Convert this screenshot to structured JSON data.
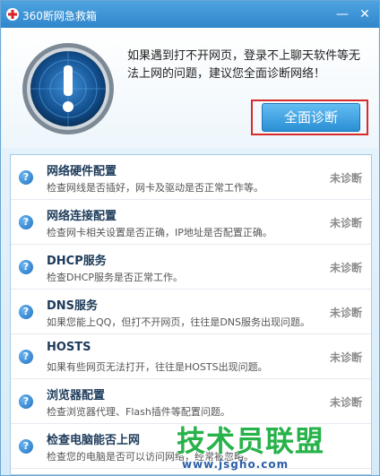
{
  "window": {
    "title": "360断网急救箱",
    "minimize": "—",
    "close": "✕"
  },
  "header": {
    "intro": "如果遇到打不开网页，登录不上聊天软件等无法上网的问题，建议您全面诊断网络！",
    "diagnose_button": "全面诊断"
  },
  "list": {
    "items": [
      {
        "title": "网络硬件配置",
        "desc": "检查网线是否插好，网卡及驱动是否正常工作等。",
        "status": "未诊断"
      },
      {
        "title": "网络连接配置",
        "desc": "检查网卡相关设置是否正确，IP地址是否配置正确。",
        "status": "未诊断"
      },
      {
        "title": "DHCP服务",
        "desc": "检查DHCP服务是否正常工作。",
        "status": "未诊断"
      },
      {
        "title": "DNS服务",
        "desc": "如果您能上QQ，但打不开网页，往往是DNS服务出现问题。",
        "status": "未诊断"
      },
      {
        "title": "HOSTS",
        "desc": "如果有些网页无法打开，往往是HOSTS出现问题。",
        "status": "未诊断"
      },
      {
        "title": "浏览器配置",
        "desc": "检查浏览器代理、Flash插件等配置问题。",
        "status": "未诊断"
      },
      {
        "title": "检查电脑能否上网",
        "desc": "检查您的电脑是否可以访问网络，经常被忽略。",
        "status": ""
      }
    ],
    "help_glyph": "?"
  },
  "watermark": {
    "main": "技术员联盟",
    "url": "www.jsgho.com"
  },
  "colors": {
    "titlebar": "#2f86cb",
    "accent": "#2a8fd5",
    "highlight_frame": "#d92b2b",
    "watermark_green": "#27b24a"
  }
}
